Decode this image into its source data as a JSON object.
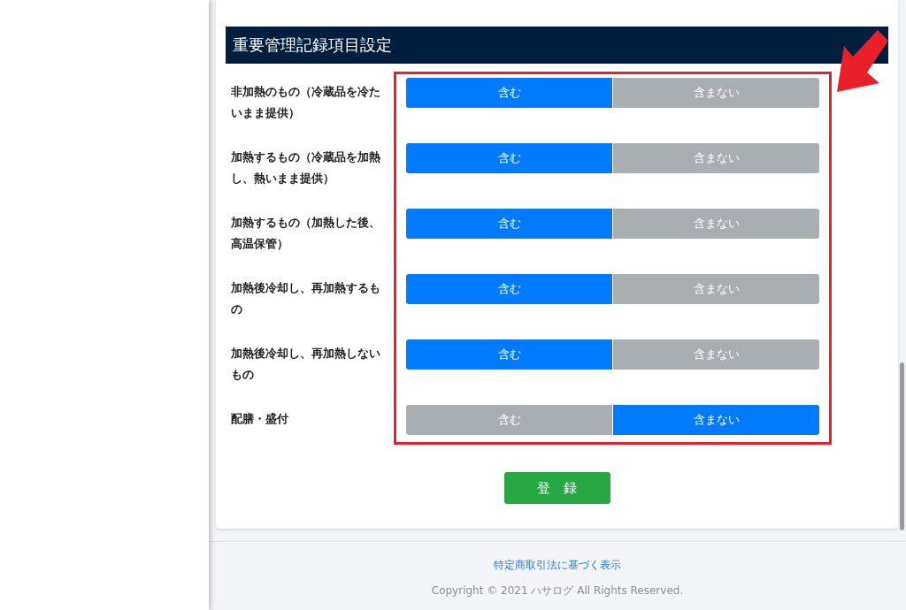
{
  "section": {
    "title": "重要管理記録項目設定"
  },
  "rows": [
    {
      "label": "非加熱のもの（冷蔵品を冷たいまま提供）",
      "options": [
        {
          "label": "含む",
          "selected": true
        },
        {
          "label": "含まない",
          "selected": false
        }
      ]
    },
    {
      "label": "加熱するもの（冷蔵品を加熱し、熱いまま提供）",
      "options": [
        {
          "label": "含む",
          "selected": true
        },
        {
          "label": "含まない",
          "selected": false
        }
      ]
    },
    {
      "label": "加熱するもの（加熱した後、高温保管）",
      "options": [
        {
          "label": "含む",
          "selected": true
        },
        {
          "label": "含まない",
          "selected": false
        }
      ]
    },
    {
      "label": "加熱後冷却し、再加熱するもの",
      "options": [
        {
          "label": "含む",
          "selected": true
        },
        {
          "label": "含まない",
          "selected": false
        }
      ]
    },
    {
      "label": "加熱後冷却し、再加熱しないもの",
      "options": [
        {
          "label": "含む",
          "selected": true
        },
        {
          "label": "含まない",
          "selected": false
        }
      ]
    },
    {
      "label": "配膳・盛付",
      "options": [
        {
          "label": "含む",
          "selected": false
        },
        {
          "label": "含まない",
          "selected": true
        }
      ]
    }
  ],
  "submit_button": "登　録",
  "footer": {
    "link": "特定商取引法に基づく表示",
    "copyright": "Copyright © 2021 ハサログ All Rights Reserved."
  }
}
